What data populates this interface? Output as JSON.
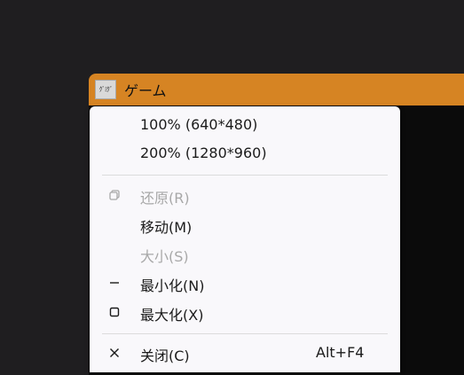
{
  "window": {
    "title": "ゲーム",
    "icon_text": "ｸﾞﾐｸﾞ",
    "titlebar_color": "#d68423"
  },
  "system_menu": {
    "items": [
      {
        "label": "100% (640*480)",
        "enabled": true
      },
      {
        "label": "200% (1280*960)",
        "enabled": true
      },
      {
        "label": "还原(R)",
        "enabled": false,
        "icon": "restore-icon"
      },
      {
        "label": "移动(M)",
        "enabled": true
      },
      {
        "label": "大小(S)",
        "enabled": false
      },
      {
        "label": "最小化(N)",
        "enabled": true,
        "icon": "minimize-icon"
      },
      {
        "label": "最大化(X)",
        "enabled": true,
        "icon": "maximize-icon"
      },
      {
        "label": "关闭(C)",
        "enabled": true,
        "icon": "close-icon",
        "shortcut": "Alt+F4"
      }
    ]
  }
}
